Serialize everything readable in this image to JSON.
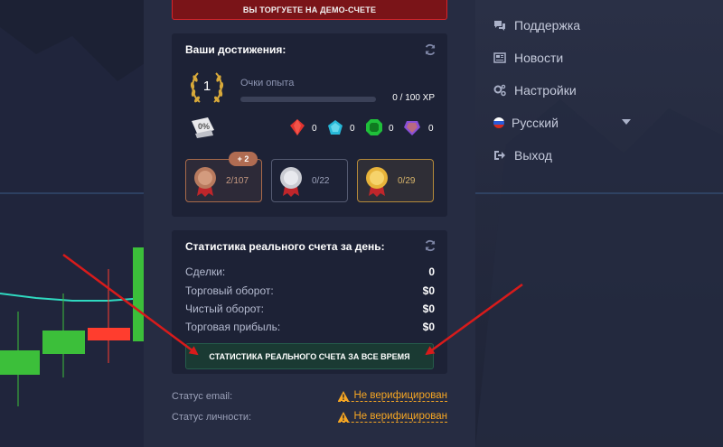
{
  "demo_banner": "ВЫ ТОРГУЕТЕ НА ДЕМО-СЧЕТЕ",
  "achievements": {
    "title": "Ваши достижения:",
    "level": "1",
    "xp_label": "Очки опыта",
    "xp_value": "0 / 100 XP",
    "xp_progress": 0,
    "sale_icon": "percent-tag-icon",
    "gems": [
      {
        "icon": "red-gem-icon",
        "count": "0",
        "color": "#e0332f"
      },
      {
        "icon": "blue-gem-icon",
        "count": "0",
        "color": "#27b8d8"
      },
      {
        "icon": "green-gem-icon",
        "count": "0",
        "color": "#1fbf3a"
      },
      {
        "icon": "purple-gem-icon",
        "count": "0",
        "color": "#8a4fd8"
      }
    ],
    "medals": [
      {
        "icon": "bronze-medal-icon",
        "count": "2/107",
        "badge": "+ 2",
        "color": "#b87a5e"
      },
      {
        "icon": "silver-medal-icon",
        "count": "0/22",
        "color": "#c9cbd2"
      },
      {
        "icon": "gold-medal-icon",
        "count": "0/29",
        "color": "#e7b33a"
      }
    ]
  },
  "stats": {
    "title": "Статистика реального счета за день:",
    "rows": [
      {
        "label": "Сделки:",
        "value": "0"
      },
      {
        "label": "Торговый оборот:",
        "value": "$0"
      },
      {
        "label": "Чистый оборот:",
        "value": "$0"
      },
      {
        "label": "Торговая прибыль:",
        "value": "$0"
      }
    ],
    "all_time_button": "СТАТИСТИКА РЕАЛЬНОГО СЧЕТА ЗА ВСЕ ВРЕМЯ"
  },
  "verification": [
    {
      "label": "Статус email:",
      "status": "Не верифицирован"
    },
    {
      "label": "Статус личности:",
      "status": "Не верифицирован"
    }
  ],
  "menu": {
    "support": "Поддержка",
    "news": "Новости",
    "settings": "Настройки",
    "language": "Русский",
    "logout": "Выход"
  },
  "colors": {
    "accent_green": "#1fbf3a",
    "candle_red": "#ff3d2e",
    "warning": "#f6a623",
    "demo_red": "#d8242a",
    "arrow_red": "#d81b1b"
  }
}
